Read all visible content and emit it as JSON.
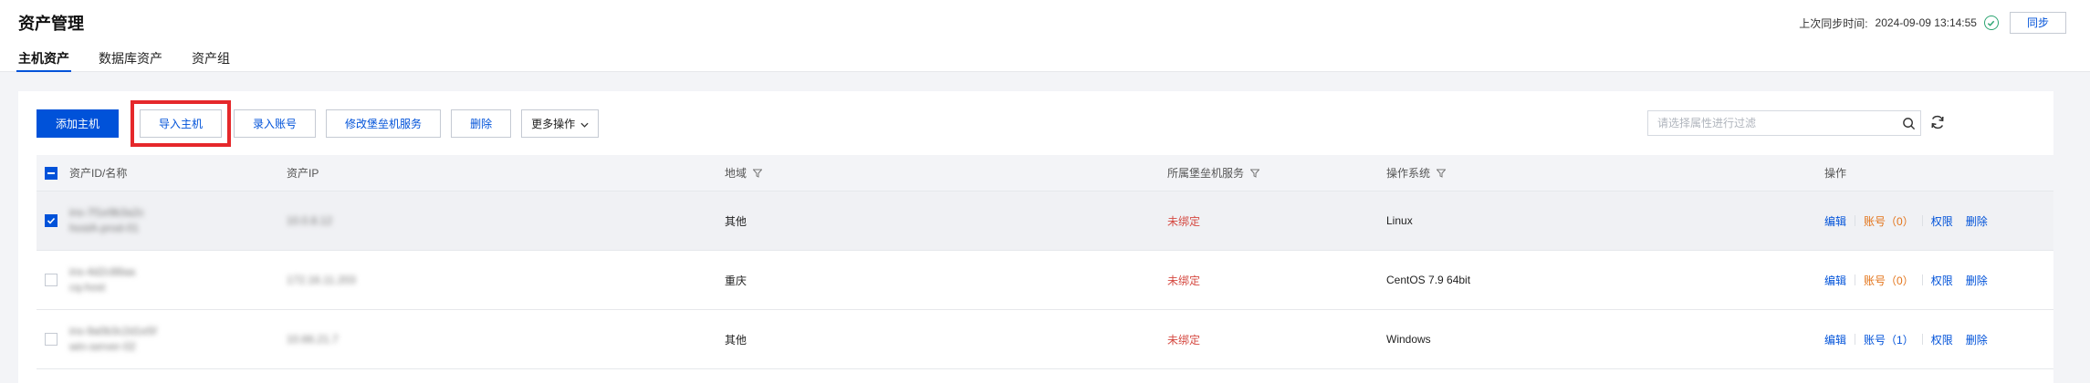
{
  "header": {
    "title": "资产管理",
    "tabs": [
      {
        "label": "主机资产",
        "active": true
      },
      {
        "label": "数据库资产",
        "active": false
      },
      {
        "label": "资产组",
        "active": false
      }
    ],
    "sync_label": "上次同步时间:",
    "sync_time": "2024-09-09 13:14:55",
    "sync_button": "同步"
  },
  "toolbar": {
    "add_host": "添加主机",
    "import_host": "导入主机",
    "enter_account": "录入账号",
    "modify_bastion": "修改堡垒机服务",
    "delete": "删除",
    "more_ops": "更多操作"
  },
  "search": {
    "placeholder": "请选择属性进行过滤"
  },
  "table": {
    "columns": {
      "asset_id": "资产ID/名称",
      "asset_ip": "资产IP",
      "region": "地域",
      "bastion": "所属堡垒机服务",
      "os": "操作系统",
      "ops": "操作"
    },
    "rows": [
      {
        "id_line1": "ins-7f1e9b3a2c",
        "id_line2": "hostA-prod-01",
        "ip": "10.0.8.12",
        "region": "其他",
        "bastion": "未绑定",
        "os": "Linux",
        "account": "账号（0）",
        "account_zero": true,
        "selected": true
      },
      {
        "id_line1": "ins-4d2c88aa",
        "id_line2": "cq-host",
        "ip": "172.16.11.203",
        "region": "重庆",
        "bastion": "未绑定",
        "os": "CentOS 7.9 64bit",
        "account": "账号（0）",
        "account_zero": true,
        "selected": false
      },
      {
        "id_line1": "ins-9a0b3c2d1e5f",
        "id_line2": "win-server-02",
        "ip": "10.66.21.7",
        "region": "其他",
        "bastion": "未绑定",
        "os": "Windows",
        "account": "账号（1）",
        "account_zero": false,
        "selected": false
      }
    ],
    "op_labels": {
      "edit": "编辑",
      "permission": "权限",
      "delete": "删除"
    }
  },
  "colors": {
    "accent": "#0052d9",
    "danger": "#d54941",
    "warning": "#e37318",
    "success": "#2ba471",
    "highlight": "#e5282b"
  },
  "icons": [
    "check-circle-icon",
    "chevron-down-icon",
    "search-icon",
    "refresh-icon",
    "filter-icon",
    "checkbox-icon"
  ]
}
